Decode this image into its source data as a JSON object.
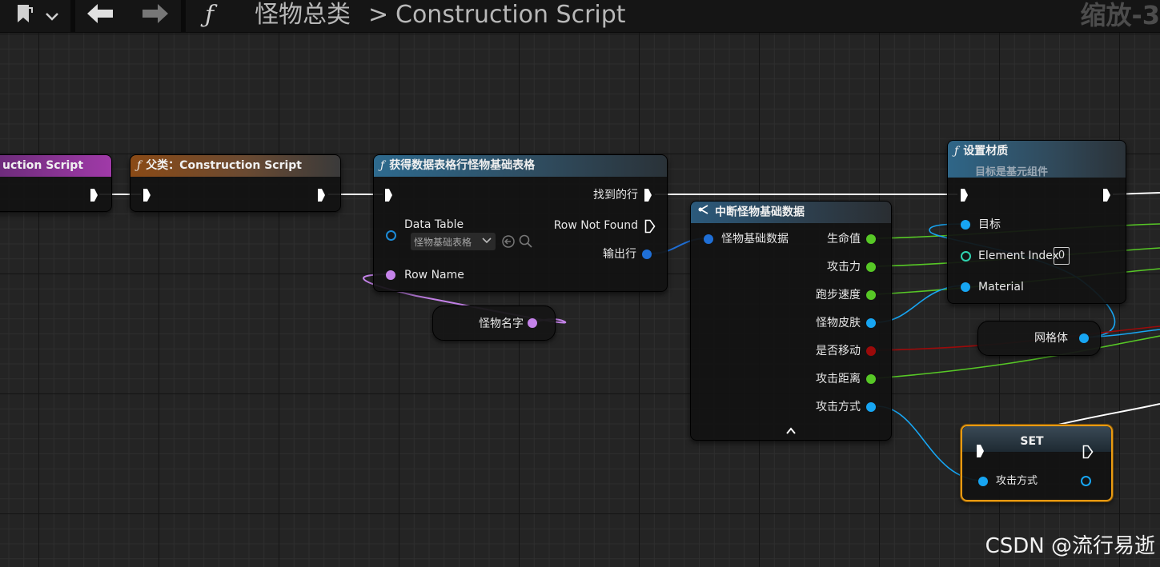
{
  "toolbar": {
    "bookmark_icon": "bookmark-icon",
    "back_icon": "arrow-left-icon",
    "forward_icon": "arrow-right-icon",
    "function_icon": "ƒ",
    "breadcrumb_parent": "怪物总类",
    "breadcrumb_separator": ">",
    "breadcrumb_current": "Construction Script",
    "zoom": "缩放-3"
  },
  "nodes": {
    "construction_script": {
      "title": "uction Script"
    },
    "parent_construction": {
      "title": "父类：Construction Script"
    },
    "get_data_table_row": {
      "title": "获得数据表格行怪物基础表格",
      "data_table_label": "Data Table",
      "data_table_value": "怪物基础表格",
      "row_name_label": "Row Name",
      "row_found_label": "找到的行",
      "row_not_found_label": "Row Not Found",
      "out_row_label": "输出行"
    },
    "monster_name_var": {
      "label": "怪物名字"
    },
    "break_struct": {
      "title": "中断怪物基础数据",
      "input_label": "怪物基础数据",
      "outputs": [
        "生命值",
        "攻击力",
        "跑步速度",
        "怪物皮肤",
        "是否移动",
        "攻击距离",
        "攻击方式"
      ],
      "collapse_icon": "chevron-up-icon"
    },
    "set_material": {
      "title": "设置材质",
      "subtitle": "目标是基元组件",
      "target_label": "目标",
      "element_index_label": "Element Index",
      "element_index_value": "0",
      "material_label": "Material"
    },
    "mesh_var": {
      "label": "网格体"
    },
    "set_node": {
      "title": "SET",
      "pin_label": "攻击方式"
    }
  },
  "colors": {
    "exec": "#ffffff",
    "struct_pin": "#1f6fd6",
    "float_pin": "#57c826",
    "object_pin": "#17a5f2",
    "bool_pin": "#9b0a0a",
    "name_pin": "#c583ea",
    "set_highlight": "#e89a12"
  },
  "watermark": "CSDN @流行易逝"
}
